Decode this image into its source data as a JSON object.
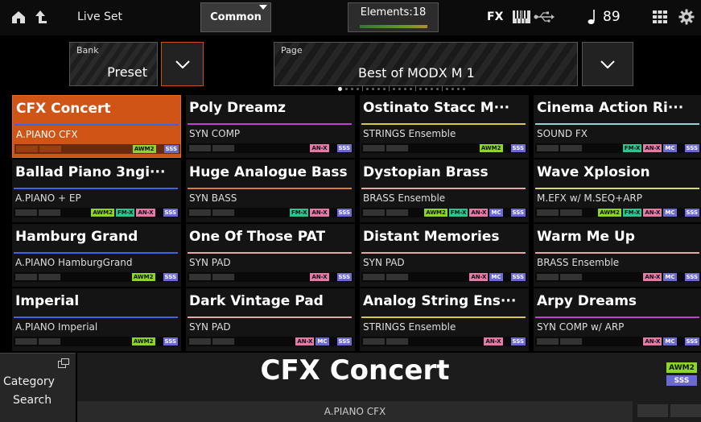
{
  "topbar": {
    "home_icon": "home-icon",
    "up_icon": "up-arrow-icon",
    "liveset_label": "Live Set",
    "common_label": "Common",
    "elements_label": "Elements:18",
    "fx_label": "FX",
    "tempo": "89",
    "icons": [
      "keyboard-icon",
      "usb-icon",
      "quarter-note-icon",
      "grid-icon",
      "gear-icon"
    ]
  },
  "bank": {
    "label": "Bank",
    "value": "Preset"
  },
  "page": {
    "label": "Page",
    "value": "Best of MODX M 1"
  },
  "tiles": [
    {
      "name": "CFX Concert",
      "category": "A.PIANO CFX",
      "color": "#3d64e8",
      "badges": [
        "AWM2",
        "SSS"
      ],
      "selected": true
    },
    {
      "name": "Poly Dreamz",
      "category": "SYN COMP",
      "color": "#c43dd4",
      "badges": [
        "AN-X",
        "SSS"
      ]
    },
    {
      "name": "Ostinato Stacc M···",
      "category": "STRINGS Ensemble",
      "color": "#d8c84a",
      "badges": [
        "AWM2",
        "SSS"
      ]
    },
    {
      "name": "Cinema Action Ri···",
      "category": "SOUND FX",
      "color": "#8ed6d6",
      "badges": [
        "FM-X",
        "AN-X",
        "MC",
        "SSS"
      ]
    },
    {
      "name": "Ballad Piano 3ngi···",
      "category": "A.PIANO + EP",
      "color": "#3d64e8",
      "badges": [
        "AWM2",
        "FM-X",
        "AN-X",
        "SSS"
      ]
    },
    {
      "name": "Huge Analogue Bass",
      "category": "SYN BASS",
      "color": "#e07a3a",
      "badges": [
        "FM-X",
        "AN-X",
        "SSS"
      ]
    },
    {
      "name": "Dystopian Brass",
      "category": "BRASS Ensemble",
      "color": "#e8a7a7",
      "badges": [
        "AWM2",
        "FM-X",
        "AN-X",
        "MC",
        "SSS"
      ]
    },
    {
      "name": "Wave Xplosion",
      "category": "M.EFX w/ M.SEQ+ARP",
      "color": "#d8d86a",
      "badges": [
        "AWM2",
        "FM-X",
        "AN-X",
        "MC",
        "SSS"
      ]
    },
    {
      "name": "Hamburg Grand",
      "category": "A.PIANO HamburgGrand",
      "color": "#3d64e8",
      "badges": [
        "AWM2",
        "SSS"
      ]
    },
    {
      "name": "One Of Those PAT",
      "category": "SYN PAD",
      "color": "#e8a7a7",
      "badges": [
        "AN-X",
        "SSS"
      ]
    },
    {
      "name": "Distant Memories",
      "category": "SYN PAD",
      "color": "#e8a7a7",
      "badges": [
        "AN-X",
        "MC",
        "SSS"
      ]
    },
    {
      "name": "Warm Me Up",
      "category": "BRASS Ensemble",
      "color": "#e8a7a7",
      "badges": [
        "AN-X",
        "MC",
        "SSS"
      ]
    },
    {
      "name": "Imperial",
      "category": "A.PIANO Imperial",
      "color": "#3d64e8",
      "badges": [
        "AWM2",
        "SSS"
      ]
    },
    {
      "name": "Dark Vintage Pad",
      "category": "SYN PAD",
      "color": "#e8a7a7",
      "badges": [
        "AN-X",
        "MC",
        "SSS"
      ]
    },
    {
      "name": "Analog String Ens···",
      "category": "STRINGS Ensemble",
      "color": "#d8c84a",
      "badges": [
        "AN-X",
        "SSS"
      ]
    },
    {
      "name": "Arpy Dreams",
      "category": "SYN COMP w/ ARP",
      "color": "#c43dd4",
      "badges": [
        "AN-X",
        "MC",
        "SSS"
      ]
    }
  ],
  "category_search": {
    "line1": "Category",
    "line2": "Search"
  },
  "selected": {
    "name": "CFX Concert",
    "category": "A.PIANO CFX",
    "badges": [
      "AWM2",
      "SSS"
    ]
  }
}
